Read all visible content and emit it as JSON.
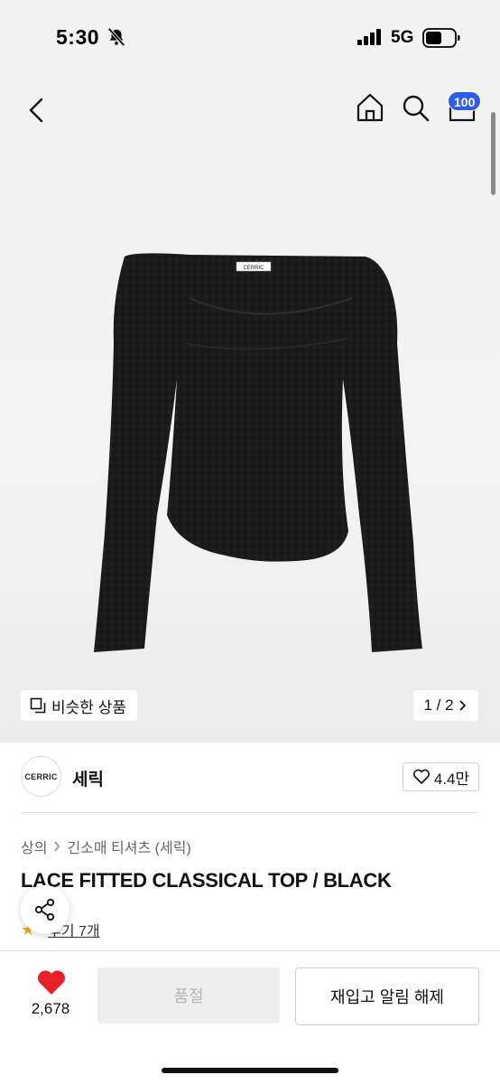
{
  "status": {
    "time": "5:30",
    "network": "5G"
  },
  "nav": {
    "cart_count": "100"
  },
  "gallery": {
    "similar_label": "비슷한 상품",
    "page_indicator": "1 / 2",
    "product_label": "CERRIC"
  },
  "brand": {
    "logo_text": "CERRIC",
    "name": "세릭",
    "likes": "4.4만"
  },
  "breadcrumb": [
    "상의",
    "긴소매 티셔츠 (세릭)"
  ],
  "product": {
    "title": "LACE FITTED CLASSICAL TOP / BLACK",
    "review_label": "후기 7개"
  },
  "bottom_bar": {
    "like_count": "2,678",
    "soldout_label": "품절",
    "restock_label": "재입고 알림 해제"
  },
  "colors": {
    "accent": "#2e5ee8",
    "heart": "#e8202a",
    "star": "#f5a623"
  }
}
